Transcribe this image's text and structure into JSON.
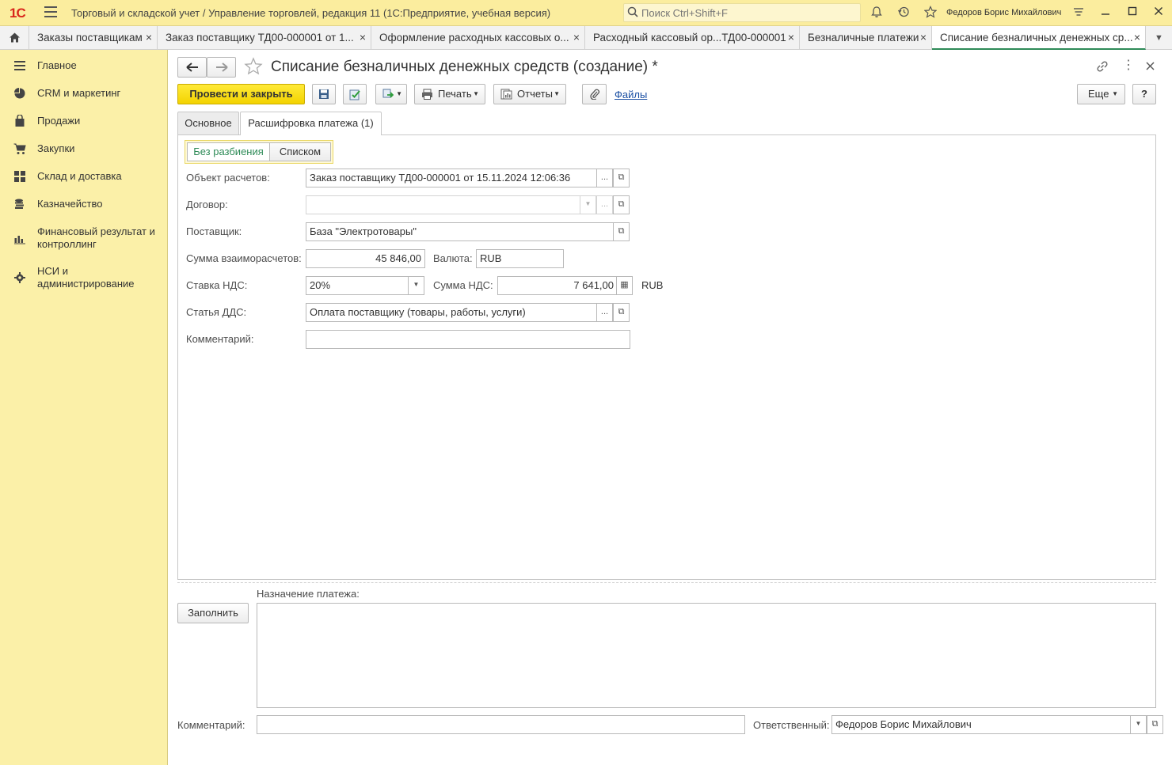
{
  "app": {
    "logo": "1С",
    "title": "Торговый и складской учет / Управление торговлей, редакция 11  (1С:Предприятие, учебная версия)",
    "search_placeholder": "Поиск Ctrl+Shift+F",
    "user": "Федоров Борис Михайлович"
  },
  "tabs": [
    {
      "label": "Заказы поставщикам",
      "close": "×"
    },
    {
      "label": "Заказ поставщику ТД00-000001 от 1...",
      "close": "×"
    },
    {
      "label": "Оформление расходных кассовых о...",
      "close": "×"
    },
    {
      "label": "Расходный кассовый ор...ТД00-000001",
      "close": "×"
    },
    {
      "label": "Безналичные платежи",
      "close": "×"
    },
    {
      "label": "Списание безналичных денежных ср...",
      "close": "×"
    }
  ],
  "sidebar": {
    "items": [
      {
        "label": "Главное"
      },
      {
        "label": "CRM и маркетинг"
      },
      {
        "label": "Продажи"
      },
      {
        "label": "Закупки"
      },
      {
        "label": "Склад и доставка"
      },
      {
        "label": "Казначейство"
      },
      {
        "label": "Финансовый результат и контроллинг"
      },
      {
        "label": "НСИ и администрирование"
      }
    ]
  },
  "form": {
    "title": "Списание безналичных денежных средств (создание) *",
    "toolbar": {
      "post_close": "Провести и закрыть",
      "print": "Печать",
      "reports": "Отчеты",
      "files": "Файлы",
      "more": "Еще",
      "help": "?"
    },
    "tabs": [
      "Основное",
      "Расшифровка платежа (1)"
    ],
    "mode_switch": [
      "Без разбиения",
      "Списком"
    ],
    "fields": {
      "settlement_object_label": "Объект расчетов:",
      "settlement_object": "Заказ поставщику ТД00-000001 от 15.11.2024 12:06:36",
      "contract_label": "Договор:",
      "contract": "",
      "supplier_label": "Поставщик:",
      "supplier": "База \"Электротовары\"",
      "amount_label": "Сумма взаиморасчетов:",
      "amount": "45 846,00",
      "currency_label": "Валюта:",
      "currency": "RUB",
      "vat_rate_label": "Ставка НДС:",
      "vat_rate": "20%",
      "vat_amount_label": "Сумма НДС:",
      "vat_amount": "7 641,00",
      "vat_currency": "RUB",
      "cash_flow_item_label": "Статья ДДС:",
      "cash_flow_item": "Оплата поставщику (товары, работы, услуги)",
      "line_comment_label": "Комментарий:",
      "line_comment": ""
    },
    "purpose_label": "Назначение платежа:",
    "purpose": "",
    "fill_button": "Заполнить",
    "comment_label": "Комментарий:",
    "comment": "",
    "responsible_label": "Ответственный:",
    "responsible": "Федоров Борис Михайлович"
  },
  "colors": {
    "sidebar_bg": "#fbf0a8",
    "titlebar_bg": "#fbed9e",
    "primary_button": "#f3d300",
    "active_tab_underline": "#2e8b57",
    "link": "#1a4fa3",
    "mode_active": "#2e8b57"
  }
}
